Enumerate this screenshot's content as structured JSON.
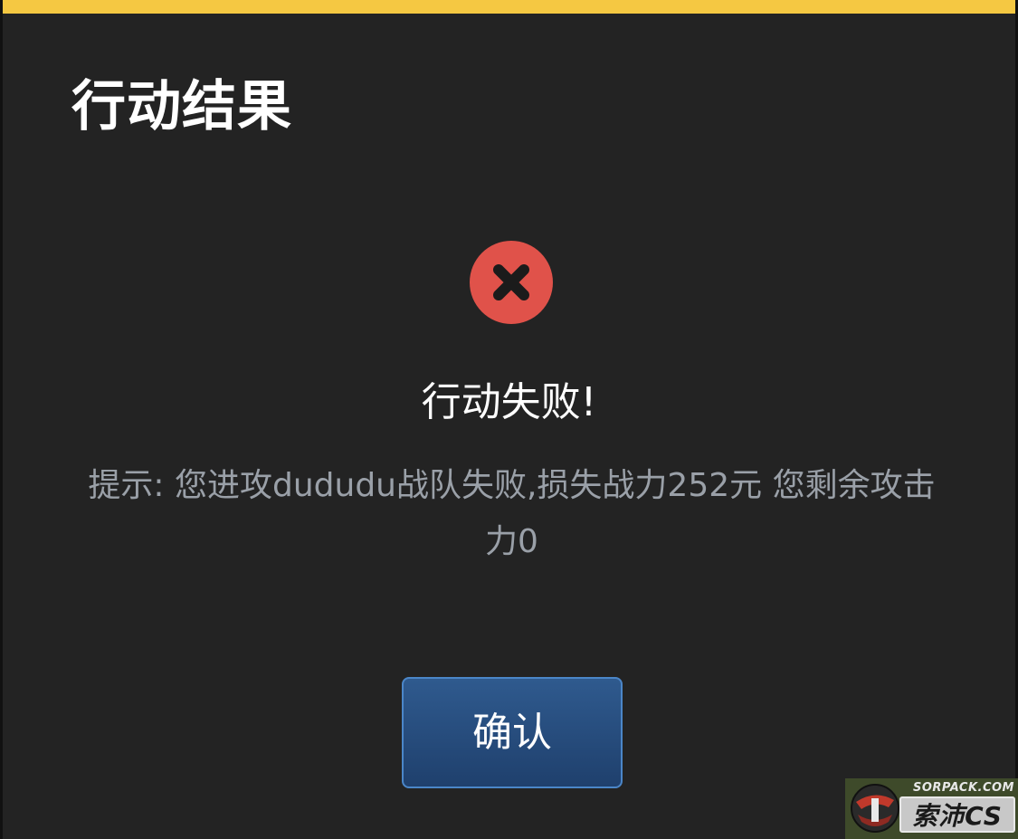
{
  "dialog": {
    "title": "行动结果",
    "result": "行动失败!",
    "hint": "提示: 您进攻dududu战队失败,损失战力252元 您剩余攻击力0",
    "confirm_label": "确认",
    "status_icon": "error-x-icon",
    "accent_color": "#f5c842",
    "error_color": "#e0524a"
  },
  "watermark": {
    "url": "SORPACK.COM",
    "brand": "索沛CS"
  }
}
